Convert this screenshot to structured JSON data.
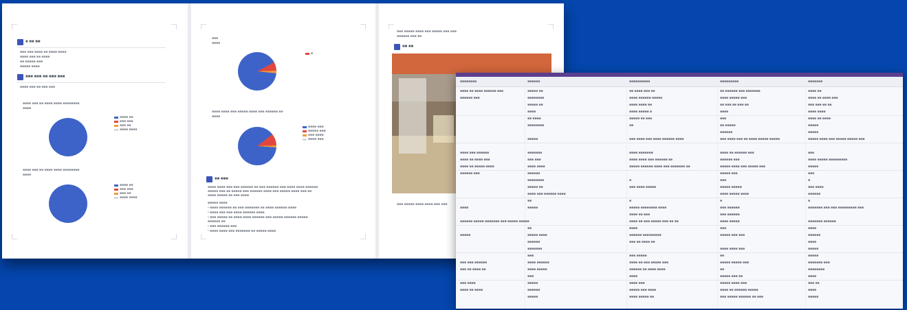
{
  "colors": {
    "background": "#0446ad",
    "accent": "#3d55b8",
    "pie_main": "#3d63c8",
    "pie_slice_red": "#e0483d",
    "pie_slice_orange": "#f29a3a",
    "sheet_header_bar": "#5b3f8f"
  },
  "document": {
    "pages": [
      {
        "id": "p1",
        "sections": [
          {
            "heading": "■ ■■ ■■",
            "lines": [
              "■■■ ■■■ ■■■■ ■■ ■■■■ ■■■■",
              "■■■■ ■■■ ■■ ■■■■",
              "■■ ■■■■■ ■■■",
              "■■■■■ ■■■■"
            ]
          },
          {
            "heading": "■■■ ■■■ ■■ ■■■ ■■■",
            "lines": [
              "■■■■ ■■■ ■■ ■■■ ■■■"
            ]
          }
        ],
        "charts": [
          {
            "caption": "■■■■ ■■■ ■■ ■■■■ ■■■■ ■■■■■■■■",
            "sub": "■■■■",
            "legend": [
              "■■■■ ■■",
              "■■■ ■■■",
              "■■■ ■■",
              "■■■■ ■■■■"
            ]
          },
          {
            "caption": "■■■■ ■■■ ■■ ■■■■ ■■■■ ■■■■■■■■",
            "sub": "■■■■",
            "legend": [
              "■■■■ ■■",
              "■■■ ■■■",
              "■■■ ■■",
              "■■■■ ■■■■"
            ]
          }
        ]
      },
      {
        "id": "p2",
        "charts": [
          {
            "caption": "■■■",
            "sub": "■■■■",
            "legend": [
              "■"
            ]
          },
          {
            "caption": "■■■■ ■■■■ ■■■ ■■■■■ ■■■■ ■■■ ■■■■■■ ■■",
            "sub": "■■■■",
            "legend": [
              "■■■■ ■■■",
              "■■■■■ ■■■",
              "■■■ ■■■■",
              "■■■■ ■■■"
            ]
          }
        ],
        "section": {
          "heading": "■■ ■■■",
          "paragraph": [
            "■■■■ ■■■■ ■■■ ■■■ ■■■■■■ ■■ ■■■ ■■■■■■ ■■■ ■■■■ ■■■■ ■■■■■■",
            "■■■■■ ■■■ ■■ ■■■■■ ■■■ ■■■■■■ ■■■■ ■■■ ■■■■■ ■■■■ ■■■ ■■",
            "■■■■ ■■■■■ ■■ ■■■ ■■■■"
          ],
          "bullets": [
            "■■■■■ ■■■■",
            "• ■■■■ ■■■■■■ ■■ ■■■ ■■■■■■■ ■■ ■■■■ ■■■■■■ ■■■■",
            "• ■■■■ ■■■ ■■■ ■■■■ ■■■■■■ ■■■■",
            "• ■■■ ■■■■■ ■■ ■■■■ ■■■■ ■■■■■■ ■■■ ■■■■■ ■■■■■■ ■■■■■",
            "  ■■■■■■ ■■",
            "• ■■■ ■■■■■■ ■■■",
            "• ■■■■ ■■■■ ■■■ ■■■■■■■ ■■ ■■■■■ ■■■■"
          ]
        }
      },
      {
        "id": "p3",
        "top_lines": [
          "■■■ ■■■■■ ■■■■ ■■■ ■■■■■ ■■■ ■■■",
          "■■■■■■ ■■■ ■■"
        ],
        "heading": "■■ ■■",
        "photo_caption": "■■■ ■■■■■ ■■■■ ■■■■ ■■■ ■■■"
      }
    ]
  },
  "spreadsheet": {
    "columns": [
      "■■■■■■■■",
      "■■■■■■",
      "■■■■■■■■■■",
      "■■■■■■■■■",
      "■■■■■■■"
    ],
    "rows": [
      [
        "■■■■ ■■ ■■■■ ■■■■■■ ■■■",
        "■■■■■ ■■",
        "■■ ■■■■ ■■■ ■■",
        "■■ ■■■■■■ ■■■ ■■■■■■■",
        "■■■■ ■■"
      ],
      [
        "■■■■■■ ■■■",
        "■■■■■■■■",
        "■■■■ ■■■■■■ ■■■■■",
        "■■■■ ■■■■■ ■■■",
        "■■■■ ■■ ■■■■ ■■■"
      ],
      [
        "",
        "■■■■■ ■■",
        "■■■■ ■■■■ ■■",
        "■■ ■■■ ■■ ■■■ ■■",
        "■■■ ■■■ ■■ ■■"
      ],
      [
        "",
        "■■■■",
        "■■■■ ■■■■■ ■",
        "■■■■",
        "■■■■ ■■■■"
      ],
      [
        "",
        "■■ ■■■■",
        "■■■■■ ■■ ■■■",
        "■■■",
        "■■■■ ■■ ■■■■"
      ],
      [
        "",
        "■■■■■■■■",
        "■■",
        "■■ ■■■■■",
        "■■■■■"
      ],
      [
        "",
        "",
        "",
        "■■■■■■",
        "■■■■■"
      ],
      [
        "",
        "■■■■■",
        "■■■ ■■■■ ■■■ ■■■■ ■■■■■■ ■■■■",
        "■■■ ■■■■ ■■■ ■■ ■■■■ ■■■■■ ■■■■■",
        "■■■■■ ■■■■ ■■■ ■■■■■ ■■■■■ ■■■"
      ],
      [
        "",
        "",
        "",
        "",
        ""
      ],
      [
        "■■■■ ■■■ ■■■■■■",
        "■■■■■■■",
        "■■■■ ■■■■■■■",
        "■■■■ ■■ ■■■■■■ ■■■",
        "■■■"
      ],
      [
        "■■■■ ■■ ■■■■ ■■■",
        "■■■ ■■■",
        "■■■■ ■■■■ ■■■ ■■■■■■ ■■",
        "■■■■■■ ■■■",
        "■■■■ ■■■■■ ■■■■■■■■■"
      ],
      [
        "■■■■ ■■ ■■■■■ ■■■■",
        "■■■■ ■■■■",
        "■■■■■ ■■■■■■ ■■■■ ■■■ ■■■■■■■ ■■",
        "■■■■■ ■■■■ ■■■ ■■■■■ ■■■",
        "■■■■■"
      ],
      [
        "■■■■■■ ■■■",
        "■■■■■■",
        "",
        "■■■■■ ■■■",
        "■■■"
      ],
      [
        "",
        "■■■■■■■■",
        "■",
        "■■■",
        "■"
      ],
      [
        "",
        "■■■■■ ■■",
        "■■■ ■■■■ ■■■■■",
        "■■■■■ ■■■■■",
        "■■■ ■■■■"
      ],
      [
        "",
        "■■■■ ■■■ ■■■■■■ ■■■■",
        "",
        "■■■■ ■■■■■ ■■■■",
        "■■■■■■"
      ],
      [
        "",
        "■■",
        "■",
        "■",
        "■"
      ],
      [
        "■■■■",
        "■■■■■",
        "■■■■■ ■■■■■■■■ ■■■■",
        "■■■ ■■■■■■",
        "■■■■■■■ ■■■ ■■■ ■■■■■■■■■ ■■■"
      ],
      [
        "",
        "",
        "■■■■ ■■ ■■■",
        "■■■ ■■■■■■",
        ""
      ],
      [
        "■■■■■■ ■■■■■ ■■■■■■■ ■■■ ■■■■■ ■■■■■",
        "",
        "■■■■ ■■ ■■■ ■■■■■ ■■■ ■■ ■■",
        "■■■■ ■■■■■",
        "■■■■■■■ ■■■■■■"
      ],
      [
        "",
        "■■",
        "■■■■",
        "■■■",
        "■■■■"
      ],
      [
        "■■■■■",
        "■■■■■ ■■■■",
        "■■■■■■ ■■■■■■■■■",
        "■■■■■ ■■■ ■■■",
        "■■■■■■"
      ],
      [
        "",
        "■■■■■■",
        "■■■ ■■ ■■■■ ■■",
        "",
        "■■■■"
      ],
      [
        "",
        "■■■■■■■",
        "",
        "■■■■ ■■■■ ■■■",
        "■■■■■"
      ],
      [
        "",
        "■■■",
        "■■■ ■■■■■",
        "■■",
        "■■■■■"
      ],
      [
        "■■■ ■■■ ■■■■■■",
        "■■■■ ■■■■■■",
        "■■■■ ■■ ■■■ ■■■■■ ■■■",
        "■■■■■ ■■■■■ ■■■",
        "■■■■■■■ ■■■"
      ],
      [
        "■■■ ■■ ■■■■ ■■",
        "■■■■ ■■■■■",
        "■■■■■■ ■■ ■■■■ ■■■■",
        "■■",
        "■■■■■■■■"
      ],
      [
        "",
        "■■■",
        "■■■■",
        "■■■■■ ■■■ ■■",
        "■■■■"
      ],
      [
        "■■■ ■■■■",
        "■■■■■",
        "■■■■ ■■■",
        "■■■■■ ■■■■ ■■■",
        "■■■ ■■"
      ],
      [
        "■■■■ ■■ ■■■■",
        "■■■■■■",
        "■■■■■ ■■■ ■■■■",
        "■■■■ ■■ ■■■■■■ ■■■■■",
        "■■■■"
      ],
      [
        "",
        "■■■■■",
        "■■■■ ■■■■■ ■■",
        "■■■ ■■■■■ ■■■■■■ ■■ ■■■",
        "■■■■■"
      ]
    ]
  }
}
